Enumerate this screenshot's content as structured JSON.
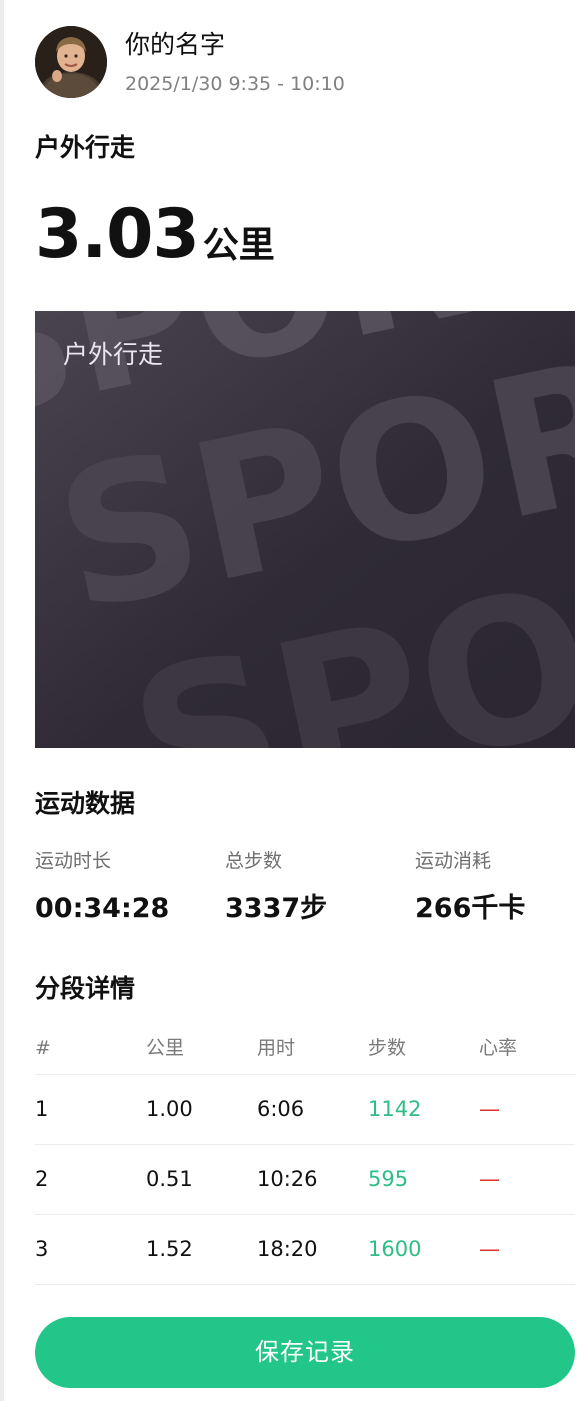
{
  "user": {
    "name": "你的名字",
    "time_range": "2025/1/30 9:35 - 10:10"
  },
  "activity": {
    "title": "户外行走",
    "distance_value": "3.03",
    "distance_unit": "公里"
  },
  "banner": {
    "label": "户外行走",
    "background_words": [
      "SPORT",
      "SPORT",
      "SPORT"
    ]
  },
  "stats": {
    "title": "运动数据",
    "items": [
      {
        "label": "运动时长",
        "value": "00:34:28"
      },
      {
        "label": "总步数",
        "value": "3337步"
      },
      {
        "label": "运动消耗",
        "value": "266千卡"
      }
    ]
  },
  "splits": {
    "title": "分段详情",
    "columns": [
      "#",
      "公里",
      "用时",
      "步数",
      "心率"
    ],
    "rows": [
      {
        "index": "1",
        "km": "1.00",
        "time": "6:06",
        "steps": "1142",
        "hr": "—"
      },
      {
        "index": "2",
        "km": "0.51",
        "time": "10:26",
        "steps": "595",
        "hr": "—"
      },
      {
        "index": "3",
        "km": "1.52",
        "time": "18:20",
        "steps": "1600",
        "hr": "—"
      }
    ]
  },
  "actions": {
    "save_label": "保存记录"
  },
  "colors": {
    "accent": "#22c688",
    "steps": "#2ebd85",
    "heart_rate": "#e0312b",
    "banner_bg": "#2e2a35"
  }
}
